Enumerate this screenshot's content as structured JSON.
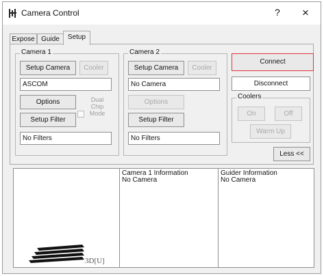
{
  "window": {
    "title": "Camera Control",
    "help_glyph": "?",
    "close_glyph": "×"
  },
  "tabs": [
    {
      "label": "Expose",
      "active": false
    },
    {
      "label": "Guide",
      "active": false
    },
    {
      "label": "Setup",
      "active": true
    }
  ],
  "camera1": {
    "title": "Camera 1",
    "setup_camera": "Setup Camera",
    "cooler": "Cooler",
    "camera_value": "ASCOM",
    "options": "Options",
    "dual_chip": "Dual Chip Mode",
    "setup_filter": "Setup Filter",
    "filter_value": "No Filters"
  },
  "camera2": {
    "title": "Camera 2",
    "setup_camera": "Setup Camera",
    "cooler": "Cooler",
    "camera_value": "No Camera",
    "options": "Options",
    "setup_filter": "Setup Filter",
    "filter_value": "No Filters"
  },
  "connection": {
    "connect": "Connect",
    "disconnect": "Disconnect",
    "coolers_title": "Coolers",
    "on": "On",
    "off": "Off",
    "warm_up": "Warm Up",
    "less": "Less <<"
  },
  "info": {
    "camera1_header": "Camera 1 Information",
    "camera1_value": "No Camera",
    "guider_header": "Guider Information",
    "guider_value": "No Camera",
    "view3d_label": "3D[U]"
  },
  "colors": {
    "connect_highlight": "#e0343a"
  }
}
